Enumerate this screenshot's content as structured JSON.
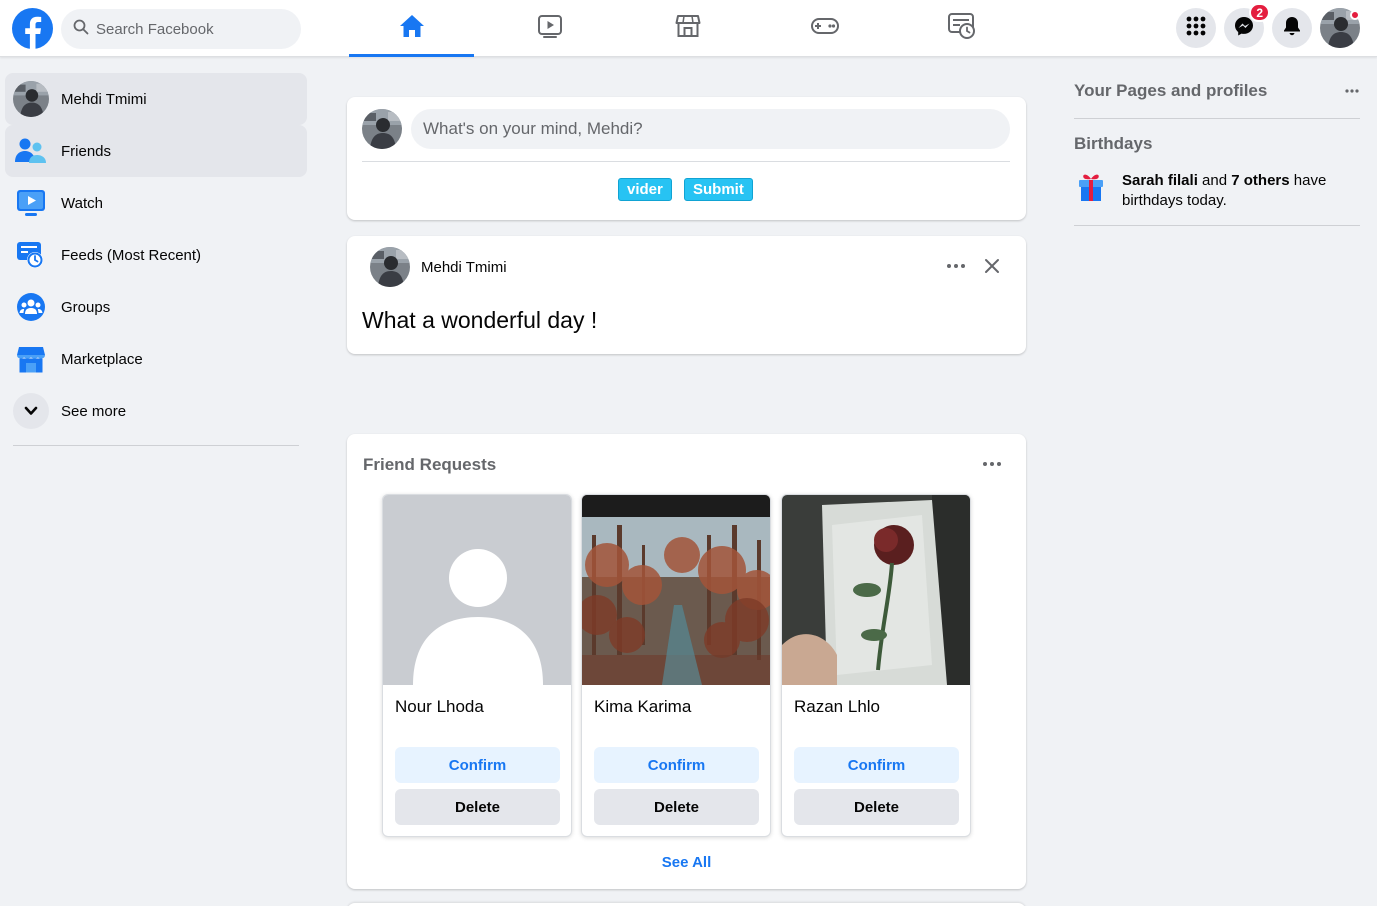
{
  "header": {
    "logo_icon": "facebook-logo-icon",
    "search": {
      "placeholder": "Search Facebook",
      "value": ""
    },
    "tabs": [
      {
        "name": "home",
        "icon": "home-icon",
        "active": true
      },
      {
        "name": "watch",
        "icon": "video-play-icon",
        "active": false
      },
      {
        "name": "marketplace",
        "icon": "store-icon",
        "active": false
      },
      {
        "name": "gaming",
        "icon": "gamepad-icon",
        "active": false
      },
      {
        "name": "feeds",
        "icon": "feed-clock-icon",
        "active": false
      }
    ],
    "right": {
      "menu_icon": "grid-menu-icon",
      "messenger_icon": "messenger-icon",
      "messenger_badge": "2",
      "notifications_icon": "bell-icon",
      "accent": "#1877f2",
      "badge_color": "#e41e3f"
    }
  },
  "sidebar": {
    "items": [
      {
        "label": "Mehdi Tmimi",
        "icon": "user-avatar",
        "highlighted": true
      },
      {
        "label": "Friends",
        "icon": "friends-icon",
        "highlighted": true
      },
      {
        "label": "Watch",
        "icon": "watch-icon",
        "highlighted": false
      },
      {
        "label": "Feeds (Most Recent)",
        "icon": "feeds-icon",
        "highlighted": false
      },
      {
        "label": "Groups",
        "icon": "groups-icon",
        "highlighted": false
      },
      {
        "label": "Marketplace",
        "icon": "marketplace-icon",
        "highlighted": false
      },
      {
        "label": "See more",
        "icon": "chevron-down-icon",
        "highlighted": false
      }
    ]
  },
  "composer": {
    "placeholder": "What's on your mind, Mehdi?",
    "value": "",
    "buttons": {
      "clear_label": "vider",
      "submit_label": "Submit"
    }
  },
  "post": {
    "author": "Mehdi Tmimi",
    "text": "What a wonderful day !"
  },
  "friend_requests": {
    "title": "Friend Requests",
    "requests": [
      {
        "name": "Nour Lhoda",
        "photo": "default-profile-silhouette",
        "confirm_label": "Confirm",
        "delete_label": "Delete"
      },
      {
        "name": "Kima Karima",
        "photo": "autumn-forest-road-photo",
        "confirm_label": "Confirm",
        "delete_label": "Delete"
      },
      {
        "name": "Razan Lhlo",
        "photo": "rose-in-ice-photo",
        "confirm_label": "Confirm",
        "delete_label": "Delete"
      }
    ],
    "see_all_label": "See All"
  },
  "right_column": {
    "pages_title": "Your Pages and profiles",
    "birthdays_title": "Birthdays",
    "birthday": {
      "name": "Sarah filali",
      "connector": " and ",
      "others": "7 others",
      "suffix": " have birthdays today."
    }
  }
}
